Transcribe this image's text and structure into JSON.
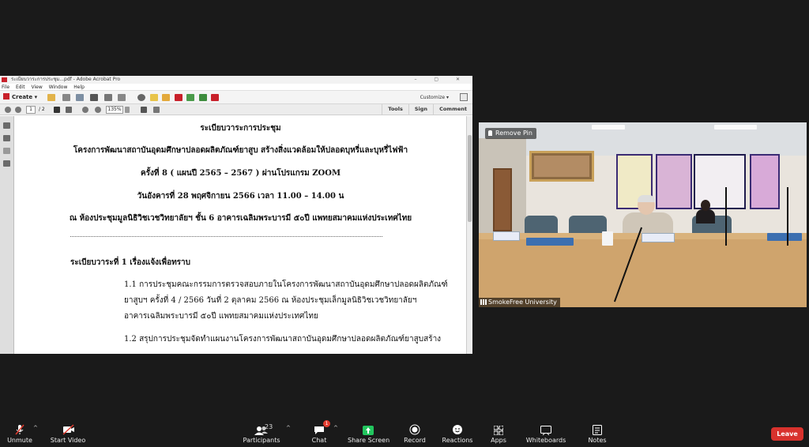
{
  "acrobat": {
    "window_title": "ระเบียบวาระการประชุม...pdf - Adobe Acrobat Pro",
    "menu": [
      "File",
      "Edit",
      "View",
      "Window",
      "Help"
    ],
    "create_label": "Create",
    "customize_label": "Customize",
    "page_current": "1",
    "page_total": "/ 2",
    "zoom": "135%",
    "right_buttons": [
      "Tools",
      "Sign",
      "Comment"
    ]
  },
  "document": {
    "title": "ระเบียบวาระการประชุม",
    "project_line": "โครงการพัฒนาสถาบันอุดมศึกษาปลอดผลิตภัณฑ์ยาสูบ สร้างสิ่งแวดล้อมให้ปลอดบุหรี่และบุหรี่ไฟฟ้า",
    "meeting_no": "ครั้งที่ 8 ( แผนปี 2565 – 2567 ) ผ่านโปรแกรม ZOOM",
    "date_line": "วันอังคารที่ 28 พฤศจิกายน 2566 เวลา 11.00 – 14.00 น",
    "venue": "ณ ห้องประชุมมูลนิธิวิชเวชวิทยาลัยฯ  ชั้น 6 อาคารเฉลิมพระบารมี ๕๐ปี แพทยสมาคมแห่งประเทศไทย",
    "agenda_heading": "ระเบียบวาระที่ 1 เรื่องแจ้งเพื่อทราบ",
    "item_1_1": [
      "1.1 การประชุมคณะกรรมการตรวจสอบภายในโครงการพัฒนาสถาบันอุดมศึกษาปลอดผลิตภัณฑ์",
      "ยาสูบฯ ครั้งที่ 4 / 2566 วันที่ 2 ตุลาคม 2566 ณ ห้องประชุมเล็กมูลนิธิวิชเวชวิทยาลัยฯ",
      "อาคารเฉลิมพระบารมี ๕๐ปี แพทยสมาคมแห่งประเทศไทย"
    ],
    "item_1_2": "1.2 สรุปการประชุมจัดทำแผนงานโครงการพัฒนาสถาบันอุดมศึกษาปลอดผลิตภัณฑ์ยาสูบสร้าง"
  },
  "video": {
    "remove_pin_label": "Remove Pin",
    "participant_name": "SmokeFree University"
  },
  "controls": {
    "unmute": "Unmute",
    "start_video": "Start Video",
    "participants": "Participants",
    "participants_count": "23",
    "chat": "Chat",
    "chat_badge": "1",
    "share_screen": "Share Screen",
    "record": "Record",
    "reactions": "Reactions",
    "apps": "Apps",
    "whiteboards": "Whiteboards",
    "notes": "Notes",
    "leave": "Leave"
  },
  "colors": {
    "leave": "#d8322d",
    "share_screen": "#22c55e",
    "muted_slash": "#e23b2e"
  }
}
